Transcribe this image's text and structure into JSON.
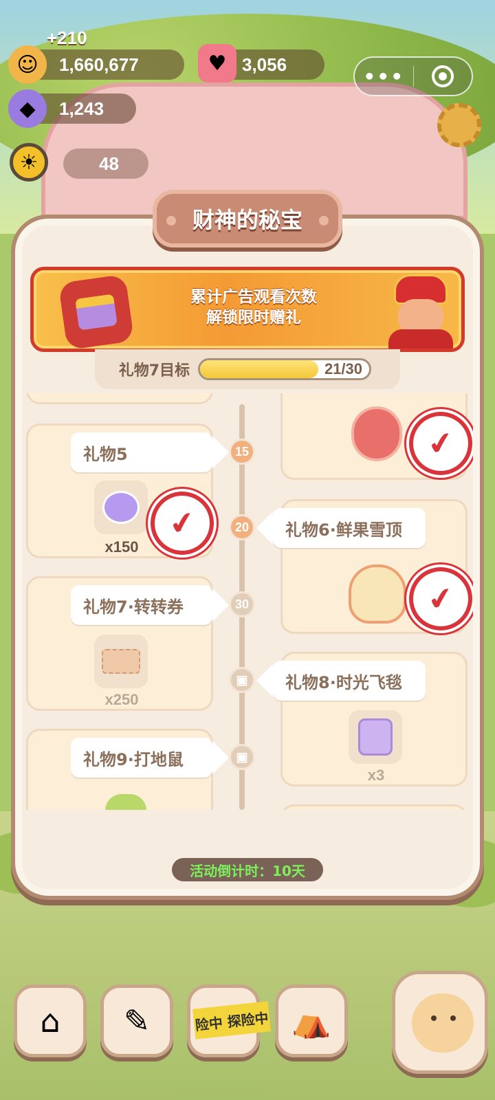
{
  "hud": {
    "gain": "+210",
    "coins": "1,660,677",
    "gems": "3,056",
    "candy": "1,243",
    "visitors": "48"
  },
  "modal": {
    "title": "财神的秘宝",
    "banner_line1": "累计广告观看次数",
    "banner_line2": "解锁限时赠礼",
    "progress_label": "礼物7目标",
    "progress_value": "21/30",
    "progress_fraction": 0.7,
    "countdown": "活动倒计时：10天"
  },
  "timeline_nodes": [
    "15",
    "20",
    "30"
  ],
  "gifts": {
    "gift5": {
      "label": "礼物5",
      "qty": "x150"
    },
    "gift6": {
      "label": "礼物6·鲜果雪顶"
    },
    "gift7": {
      "label": "礼物7·转转券",
      "qty": "x250"
    },
    "gift8": {
      "label": "礼物8·时光飞毯",
      "qty": "x3"
    },
    "gift9": {
      "label": "礼物9·打地鼠"
    }
  },
  "bottom_nav": {
    "tape_text": "险中 探险中"
  },
  "icons": {
    "coin": "cookie-coin-icon",
    "gem": "pink-gem-icon",
    "candy": "purple-candy-icon",
    "sun": "sun-icon",
    "settings": "gear-icon",
    "claimed": "check-stamp-icon",
    "gift": "gift-icon"
  },
  "colors": {
    "accent_red": "#d9343a",
    "panel": "#f7ece0",
    "countdown_text": "#7cf05a"
  }
}
